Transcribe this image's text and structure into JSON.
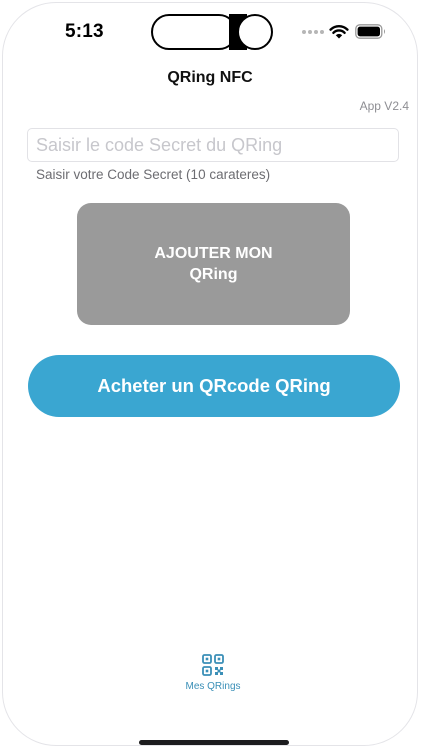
{
  "status_bar": {
    "time": "5:13",
    "icons": [
      "signal-dots-icon",
      "wifi-icon",
      "battery-icon"
    ]
  },
  "header": {
    "title": "QRing NFC"
  },
  "app_version": "App V2.4",
  "secret_input": {
    "placeholder": "Saisir le code Secret du QRing",
    "value": ""
  },
  "hint": "Saisir votre Code Secret (10 carateres)",
  "add_button": {
    "line1": "AJOUTER MON",
    "line2": "QRing"
  },
  "buy_button": {
    "label": "Acheter un QRcode QRing"
  },
  "tab_bar": {
    "items": [
      {
        "label": "Mes QRings",
        "icon": "qr-code-icon"
      }
    ]
  },
  "colors": {
    "accent": "#3aa6d1",
    "add_button_bg": "#9a9a9a",
    "tab_active": "#3a8fb7"
  }
}
